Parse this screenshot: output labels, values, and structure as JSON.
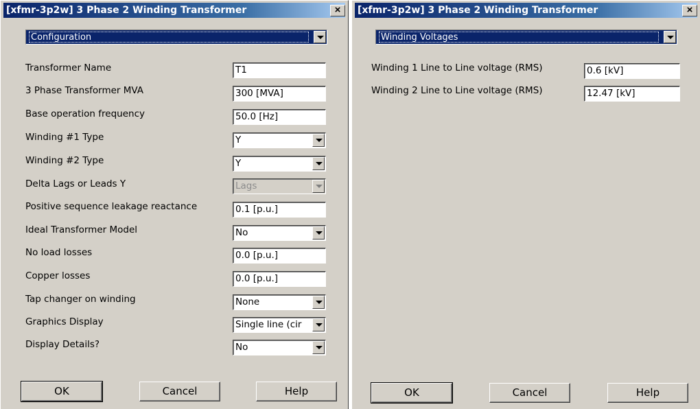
{
  "left": {
    "title": "[xfmr-3p2w] 3 Phase 2 Winding Transformer",
    "close": "×",
    "section": "Configuration",
    "rows": [
      {
        "label": "Transformer Name",
        "value": "T1",
        "type": "text"
      },
      {
        "label": "3 Phase Transformer MVA",
        "value": "300 [MVA]",
        "type": "text"
      },
      {
        "label": "Base operation frequency",
        "value": "50.0 [Hz]",
        "type": "text"
      },
      {
        "label": "Winding #1 Type",
        "value": "Y",
        "type": "select"
      },
      {
        "label": "Winding #2 Type",
        "value": "Y",
        "type": "select"
      },
      {
        "label": "Delta Lags or Leads Y",
        "value": "Lags",
        "type": "select-disabled"
      },
      {
        "label": "Positive sequence leakage reactance",
        "value": "0.1 [p.u.]",
        "type": "text"
      },
      {
        "label": "Ideal Transformer Model",
        "value": "No",
        "type": "select"
      },
      {
        "label": "No load losses",
        "value": "0.0 [p.u.]",
        "type": "text"
      },
      {
        "label": "Copper losses",
        "value": "0.0 [p.u.]",
        "type": "text"
      },
      {
        "label": "Tap changer on winding",
        "value": "None",
        "type": "select"
      },
      {
        "label": "Graphics Display",
        "value": "Single line (cir",
        "type": "select"
      },
      {
        "label": "Display Details?",
        "value": "No",
        "type": "select"
      }
    ],
    "buttons": {
      "ok": "OK",
      "cancel": "Cancel",
      "help": "Help"
    }
  },
  "right": {
    "title": "[xfmr-3p2w] 3 Phase 2 Winding Transformer",
    "close": "×",
    "section": "Winding Voltages",
    "rows": [
      {
        "label": "Winding 1 Line to Line voltage (RMS)",
        "value": "0.6 [kV]",
        "type": "text"
      },
      {
        "label": "Winding 2 Line to Line voltage (RMS)",
        "value": "12.47 [kV]",
        "type": "text"
      }
    ],
    "buttons": {
      "ok": "OK",
      "cancel": "Cancel",
      "help": "Help"
    }
  }
}
